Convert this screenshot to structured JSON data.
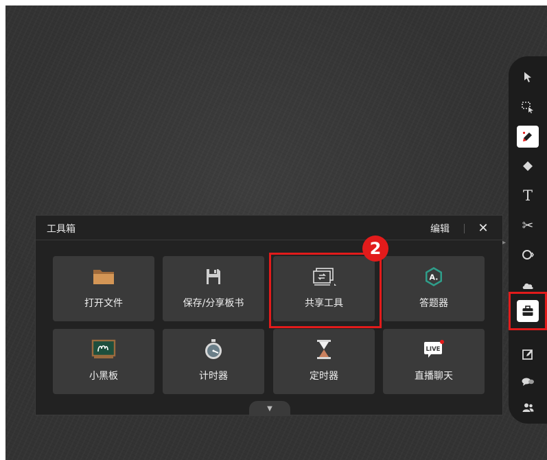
{
  "toolbar": {
    "buttons": [
      {
        "name": "select-arrow",
        "glyph": "pointer"
      },
      {
        "name": "area-select",
        "glyph": "marquee"
      },
      {
        "name": "pen",
        "glyph": "pen",
        "active": true
      },
      {
        "name": "eraser",
        "glyph": "eraser"
      },
      {
        "name": "text",
        "glyph": "T"
      },
      {
        "name": "cut",
        "glyph": "✂"
      },
      {
        "name": "shapes",
        "glyph": "shape"
      },
      {
        "name": "cloud",
        "glyph": "cloud"
      },
      {
        "name": "toolbox",
        "glyph": "toolbox",
        "active": true,
        "highlighted": true
      },
      {
        "name": "edit-note",
        "glyph": "edit"
      },
      {
        "name": "chat",
        "glyph": "chat"
      },
      {
        "name": "users",
        "glyph": "users"
      }
    ]
  },
  "panel": {
    "title": "工具箱",
    "edit_label": "编辑",
    "close_symbol": "✕",
    "tiles": [
      {
        "id": "open-file",
        "label": "打开文件",
        "icon": "folder-icon"
      },
      {
        "id": "save-share",
        "label": "保存/分享板书",
        "icon": "floppy-icon"
      },
      {
        "id": "share-tool",
        "label": "共享工具",
        "icon": "share-screen-icon",
        "highlighted": true
      },
      {
        "id": "answer",
        "label": "答题器",
        "icon": "answer-badge-icon",
        "badge_text": "A."
      },
      {
        "id": "blackboard",
        "label": "小黑板",
        "icon": "blackboard-icon"
      },
      {
        "id": "stopwatch",
        "label": "计时器",
        "icon": "stopwatch-icon"
      },
      {
        "id": "timer",
        "label": "定时器",
        "icon": "hourglass-icon"
      },
      {
        "id": "live-chat",
        "label": "直播聊天",
        "icon": "live-icon",
        "badge_text": "LIVE"
      }
    ]
  },
  "annotation": {
    "step_number": "2",
    "accent_color": "#e21b1b"
  }
}
